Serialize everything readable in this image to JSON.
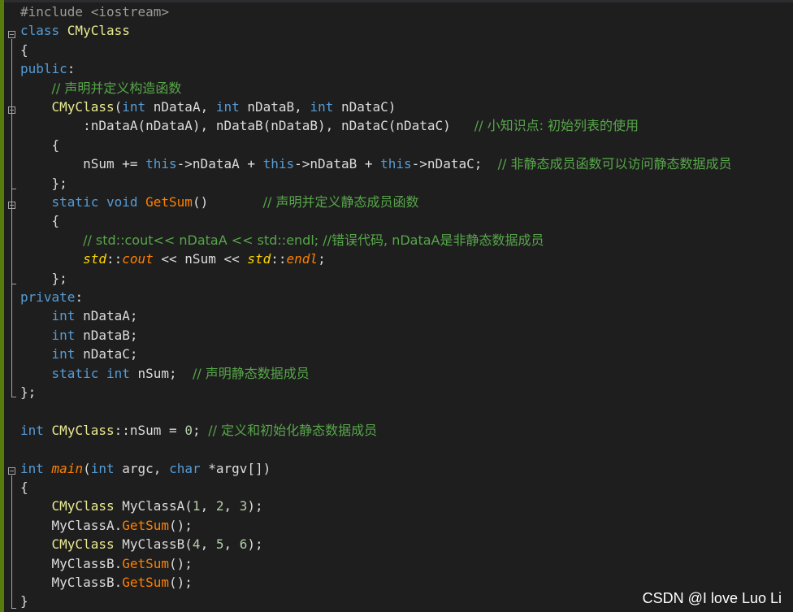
{
  "editor": {
    "lines": [
      [
        [
          "#include <iostream>",
          "pre"
        ]
      ],
      [
        [
          "class ",
          "kw"
        ],
        [
          "CMyClass",
          "cls"
        ]
      ],
      [
        [
          "{",
          "plain"
        ]
      ],
      [
        [
          "public",
          "kw"
        ],
        [
          ":",
          "plain"
        ]
      ],
      [
        [
          "    ",
          "plain"
        ],
        [
          "// 声明并定义构造函数",
          "cmt"
        ]
      ],
      [
        [
          "    ",
          "plain"
        ],
        [
          "CMyClass",
          "cls"
        ],
        [
          "(",
          "plain"
        ],
        [
          "int",
          "kw"
        ],
        [
          " nDataA, ",
          "plain"
        ],
        [
          "int",
          "kw"
        ],
        [
          " nDataB, ",
          "plain"
        ],
        [
          "int",
          "kw"
        ],
        [
          " nDataC)",
          "plain"
        ]
      ],
      [
        [
          "        :nDataA(nDataA), nDataB(nDataB), nDataC(nDataC)   ",
          "plain"
        ],
        [
          "// 小知识点: 初始列表的使用",
          "cmt"
        ]
      ],
      [
        [
          "    {",
          "plain"
        ]
      ],
      [
        [
          "        nSum += ",
          "plain"
        ],
        [
          "this",
          "kw"
        ],
        [
          "->nDataA + ",
          "plain"
        ],
        [
          "this",
          "kw"
        ],
        [
          "->nDataB + ",
          "plain"
        ],
        [
          "this",
          "kw"
        ],
        [
          "->nDataC;  ",
          "plain"
        ],
        [
          "// 非静态成员函数可以访问静态数据成员",
          "cmt"
        ]
      ],
      [
        [
          "    };",
          "plain"
        ]
      ],
      [
        [
          "    ",
          "plain"
        ],
        [
          "static",
          "kw"
        ],
        [
          " ",
          "plain"
        ],
        [
          "void",
          "kw"
        ],
        [
          " ",
          "plain"
        ],
        [
          "GetSum",
          "fn"
        ],
        [
          "()       ",
          "plain"
        ],
        [
          "// 声明并定义静态成员函数",
          "cmt"
        ]
      ],
      [
        [
          "    {",
          "plain"
        ]
      ],
      [
        [
          "        ",
          "plain"
        ],
        [
          "// std::cout<< nDataA << std::endl; //错误代码, nDataA是非静态数据成员",
          "cmt"
        ]
      ],
      [
        [
          "        ",
          "plain"
        ],
        [
          "std",
          "ns"
        ],
        [
          "::",
          "plain"
        ],
        [
          "cout",
          "it"
        ],
        [
          " << nSum << ",
          "plain"
        ],
        [
          "std",
          "ns"
        ],
        [
          "::",
          "plain"
        ],
        [
          "endl",
          "it"
        ],
        [
          ";",
          "plain"
        ]
      ],
      [
        [
          "    };",
          "plain"
        ]
      ],
      [
        [
          "private",
          "kw"
        ],
        [
          ":",
          "plain"
        ]
      ],
      [
        [
          "    ",
          "plain"
        ],
        [
          "int",
          "kw"
        ],
        [
          " nDataA;",
          "plain"
        ]
      ],
      [
        [
          "    ",
          "plain"
        ],
        [
          "int",
          "kw"
        ],
        [
          " nDataB;",
          "plain"
        ]
      ],
      [
        [
          "    ",
          "plain"
        ],
        [
          "int",
          "kw"
        ],
        [
          " nDataC;",
          "plain"
        ]
      ],
      [
        [
          "    ",
          "plain"
        ],
        [
          "static",
          "kw"
        ],
        [
          " ",
          "plain"
        ],
        [
          "int",
          "kw"
        ],
        [
          " nSum;  ",
          "plain"
        ],
        [
          "// 声明静态数据成员",
          "cmt"
        ]
      ],
      [
        [
          "};",
          "plain"
        ]
      ],
      [
        [
          "",
          "plain"
        ]
      ],
      [
        [
          "int",
          "kw"
        ],
        [
          " ",
          "plain"
        ],
        [
          "CMyClass",
          "cls"
        ],
        [
          "::nSum = ",
          "plain"
        ],
        [
          "0",
          "num"
        ],
        [
          "; ",
          "plain"
        ],
        [
          "// 定义和初始化静态数据成员",
          "cmt"
        ]
      ],
      [
        [
          "",
          "plain"
        ]
      ],
      [
        [
          "int",
          "kw"
        ],
        [
          " ",
          "plain"
        ],
        [
          "main",
          "it"
        ],
        [
          "(",
          "plain"
        ],
        [
          "int",
          "kw"
        ],
        [
          " argc, ",
          "plain"
        ],
        [
          "char",
          "kw"
        ],
        [
          " *argv[])",
          "plain"
        ]
      ],
      [
        [
          "{",
          "plain"
        ]
      ],
      [
        [
          "    ",
          "plain"
        ],
        [
          "CMyClass",
          "cls"
        ],
        [
          " MyClassA(",
          "plain"
        ],
        [
          "1",
          "num"
        ],
        [
          ", ",
          "plain"
        ],
        [
          "2",
          "num"
        ],
        [
          ", ",
          "plain"
        ],
        [
          "3",
          "num"
        ],
        [
          ");",
          "plain"
        ]
      ],
      [
        [
          "    MyClassA.",
          "plain"
        ],
        [
          "GetSum",
          "fn"
        ],
        [
          "();",
          "plain"
        ]
      ],
      [
        [
          "    ",
          "plain"
        ],
        [
          "CMyClass",
          "cls"
        ],
        [
          " MyClassB(",
          "plain"
        ],
        [
          "4",
          "num"
        ],
        [
          ", ",
          "plain"
        ],
        [
          "5",
          "num"
        ],
        [
          ", ",
          "plain"
        ],
        [
          "6",
          "num"
        ],
        [
          ");",
          "plain"
        ]
      ],
      [
        [
          "    MyClassB.",
          "plain"
        ],
        [
          "GetSum",
          "fn"
        ],
        [
          "();",
          "plain"
        ]
      ],
      [
        [
          "    MyClassB.",
          "plain"
        ],
        [
          "GetSum",
          "fn"
        ],
        [
          "();",
          "plain"
        ]
      ],
      [
        [
          "}",
          "plain"
        ]
      ]
    ]
  },
  "watermark": "CSDN @I love Luo Li",
  "colors": {
    "background": "#1e1e1e",
    "keyword": "#569cd6",
    "class": "#eaea92",
    "function": "#ff8000",
    "comment": "#57a64a",
    "gutter_change": "#587c0c"
  }
}
